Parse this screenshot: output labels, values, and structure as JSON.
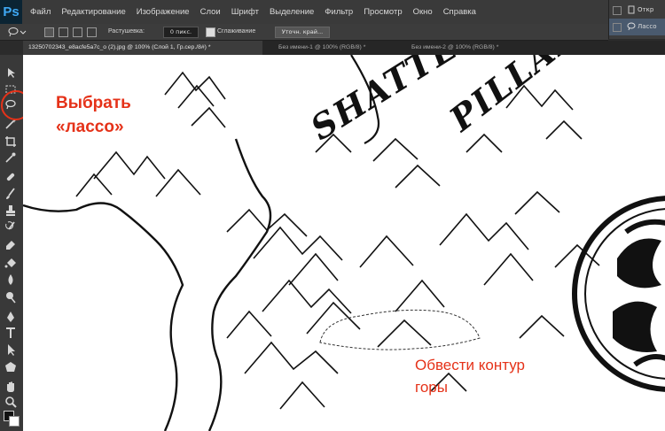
{
  "app": {
    "logo": "Ps"
  },
  "menu": [
    "Файл",
    "Редактирование",
    "Изображение",
    "Слои",
    "Шрифт",
    "Выделение",
    "Фильтр",
    "Просмотр",
    "Окно",
    "Справка"
  ],
  "history_panel": {
    "row1": "Откр",
    "row2": "Лассо"
  },
  "options": {
    "feather_label": "Растушевка:",
    "feather_value": "0 пикс.",
    "antialias_label": "Сглаживание",
    "refine_button": "Уточн. край..."
  },
  "tabs": [
    "13250702343_e8acfe5a7c_o (2).jpg @ 100% (Слой 1, Гр.сер./8#) *",
    "Без имени-1 @ 100% (RGB/8) *",
    "Без имени-2 @ 100% (RGB/8) *"
  ],
  "map_title": {
    "line1": "SHATTERED",
    "line2": "PILLARS"
  },
  "annotations": {
    "choose_lasso_1": "Выбрать",
    "choose_lasso_2": "«лассо»",
    "outline_1": "Обвести контур",
    "outline_2": "горы"
  },
  "colors": {
    "annotation": "#e53219",
    "ps_blue": "#3fa9f5"
  },
  "tool_icons": [
    "move-icon",
    "marquee-icon",
    "lasso-icon",
    "magic-wand-icon",
    "crop-icon",
    "eyedropper-icon",
    "healing-brush-icon",
    "brush-icon",
    "clone-stamp-icon",
    "history-brush-icon",
    "eraser-icon",
    "paint-bucket-icon",
    "blur-icon",
    "dodge-icon",
    "pen-icon",
    "type-icon",
    "path-selection-icon",
    "shape-icon",
    "hand-icon",
    "zoom-icon"
  ]
}
